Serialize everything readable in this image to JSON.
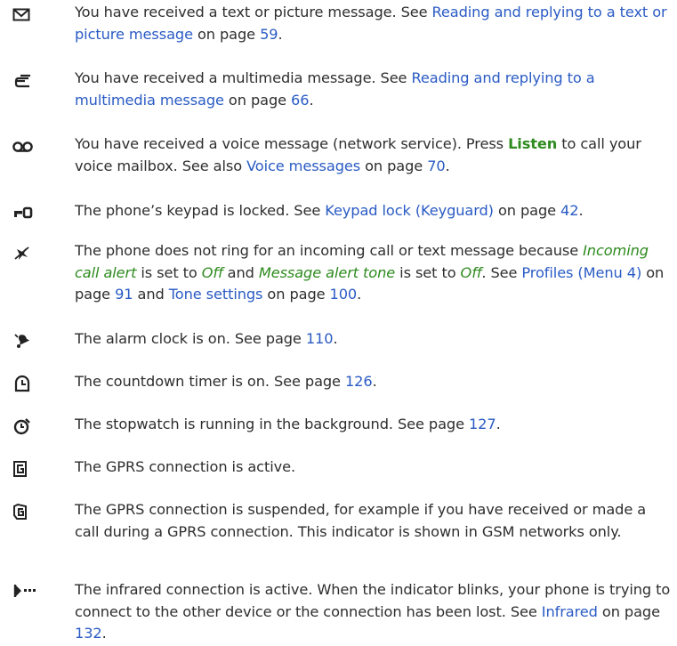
{
  "entries": [
    {
      "icon": "envelope-icon",
      "parts": [
        {
          "t": "You have received a text or picture message. See "
        },
        {
          "t": "Reading and replying to a text or picture message",
          "s": "link"
        },
        {
          "t": " on page "
        },
        {
          "t": "59",
          "s": "link"
        },
        {
          "t": "."
        }
      ]
    },
    {
      "icon": "multimedia-message-icon",
      "parts": [
        {
          "t": "You have received a multimedia message. See "
        },
        {
          "t": "Reading and replying to a multimedia message",
          "s": "link"
        },
        {
          "t": " on page "
        },
        {
          "t": "66",
          "s": "link"
        },
        {
          "t": "."
        }
      ]
    },
    {
      "icon": "voice-message-icon",
      "parts": [
        {
          "t": "You have received a voice message (network service). Press "
        },
        {
          "t": "Listen",
          "s": "green bold"
        },
        {
          "t": " to call your voice mailbox. See also "
        },
        {
          "t": "Voice messages",
          "s": "link"
        },
        {
          "t": " on page "
        },
        {
          "t": "70",
          "s": "link"
        },
        {
          "t": "."
        }
      ]
    },
    {
      "icon": "keypad-lock-icon",
      "parts": [
        {
          "t": "The phone’s keypad is locked. See "
        },
        {
          "t": "Keypad lock (Keyguard)",
          "s": "link"
        },
        {
          "t": " on page "
        },
        {
          "t": "42",
          "s": "link"
        },
        {
          "t": "."
        }
      ]
    },
    {
      "icon": "silent-icon",
      "parts": [
        {
          "t": "The phone does not ring for an incoming call or text message because "
        },
        {
          "t": "Incoming call alert",
          "s": "green it"
        },
        {
          "t": " is set to "
        },
        {
          "t": "Off",
          "s": "green it"
        },
        {
          "t": " and "
        },
        {
          "t": "Message alert tone",
          "s": "green it"
        },
        {
          "t": " is set to "
        },
        {
          "t": "Off",
          "s": "green it"
        },
        {
          "t": ". See "
        },
        {
          "t": "Profiles (Menu 4)",
          "s": "link"
        },
        {
          "t": " on page "
        },
        {
          "t": "91",
          "s": "link"
        },
        {
          "t": " and "
        },
        {
          "t": "Tone settings",
          "s": "link"
        },
        {
          "t": " on page "
        },
        {
          "t": "100",
          "s": "link"
        },
        {
          "t": "."
        }
      ]
    },
    {
      "icon": "alarm-clock-icon",
      "parts": [
        {
          "t": "The alarm clock is on. See page "
        },
        {
          "t": "110",
          "s": "link"
        },
        {
          "t": "."
        }
      ]
    },
    {
      "icon": "countdown-timer-icon",
      "parts": [
        {
          "t": "The countdown timer is on. See page "
        },
        {
          "t": "126",
          "s": "link"
        },
        {
          "t": "."
        }
      ]
    },
    {
      "icon": "stopwatch-icon",
      "parts": [
        {
          "t": "The stopwatch is running in the background. See page "
        },
        {
          "t": "127",
          "s": "link"
        },
        {
          "t": "."
        }
      ]
    },
    {
      "icon": "gprs-active-icon",
      "parts": [
        {
          "t": "The GPRS connection is active."
        }
      ]
    },
    {
      "icon": "gprs-suspended-icon",
      "parts": [
        {
          "t": "The GPRS connection is suspended, for example if you have received or made a call during a GPRS connection. This indicator is shown in GSM networks only."
        }
      ]
    },
    {
      "icon": "infrared-icon",
      "parts": [
        {
          "t": "The infrared connection is active. When the indicator blinks, your phone is trying to connect to the other device or the connection has been lost. See "
        },
        {
          "t": "Infrared",
          "s": "link"
        },
        {
          "t": " on page "
        },
        {
          "t": "132",
          "s": "link"
        },
        {
          "t": "."
        }
      ]
    }
  ]
}
